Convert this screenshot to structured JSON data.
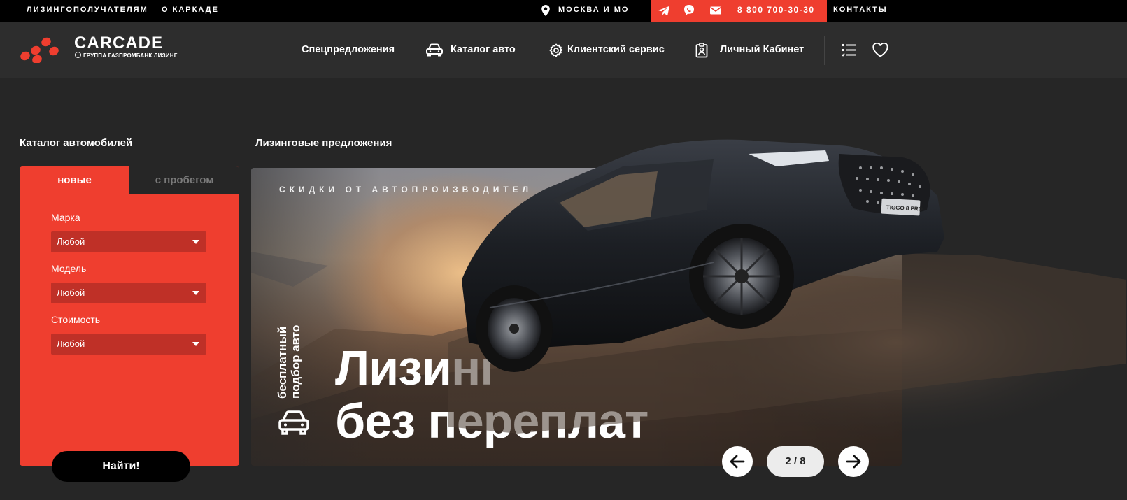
{
  "topbar": {
    "links": [
      "Лизингополучателям",
      "О каркаде"
    ],
    "city": "Москва и МО",
    "phone": "8 800 700-30-30",
    "contacts": "Контакты",
    "icons": [
      "location-pin-icon",
      "telegram-icon",
      "viber-icon",
      "mail-icon"
    ]
  },
  "header": {
    "brand": "CARCADE",
    "brand_sub": "ГРУППА ГАЗПРОМБАНК ЛИЗИНГ",
    "nav": [
      "Спецпредложения",
      "Каталог авто",
      "Клиентский сервис",
      "Личный Кабинет"
    ],
    "icons": [
      "car-icon",
      "gear-icon",
      "badge-icon",
      "compare-list-icon",
      "heart-icon"
    ]
  },
  "catalog": {
    "title": "Каталог автомобилей",
    "tabs": [
      "новые",
      "с пробегом"
    ],
    "active_tab": "новые",
    "fields": [
      {
        "label": "Марка",
        "value": "Любой"
      },
      {
        "label": "Модель",
        "value": "Любой"
      },
      {
        "label": "Стоимость",
        "value": "Любой"
      }
    ],
    "submit": "Найти!"
  },
  "offers": {
    "title": "Лизинговые предложения",
    "kicker": "Скидки от автопроизводител",
    "vertical_text": "бесплатный подбор авто",
    "headline_line1": "Лизинг",
    "headline_line2": "без переплат",
    "car_badge": "TIGGO 8 PRO",
    "pager": "2 / 8"
  },
  "colors": {
    "accent": "#ef3e2f",
    "background": "#262626",
    "header": "#2d2d2d",
    "topbar": "#000000",
    "select": "#bf3027"
  }
}
